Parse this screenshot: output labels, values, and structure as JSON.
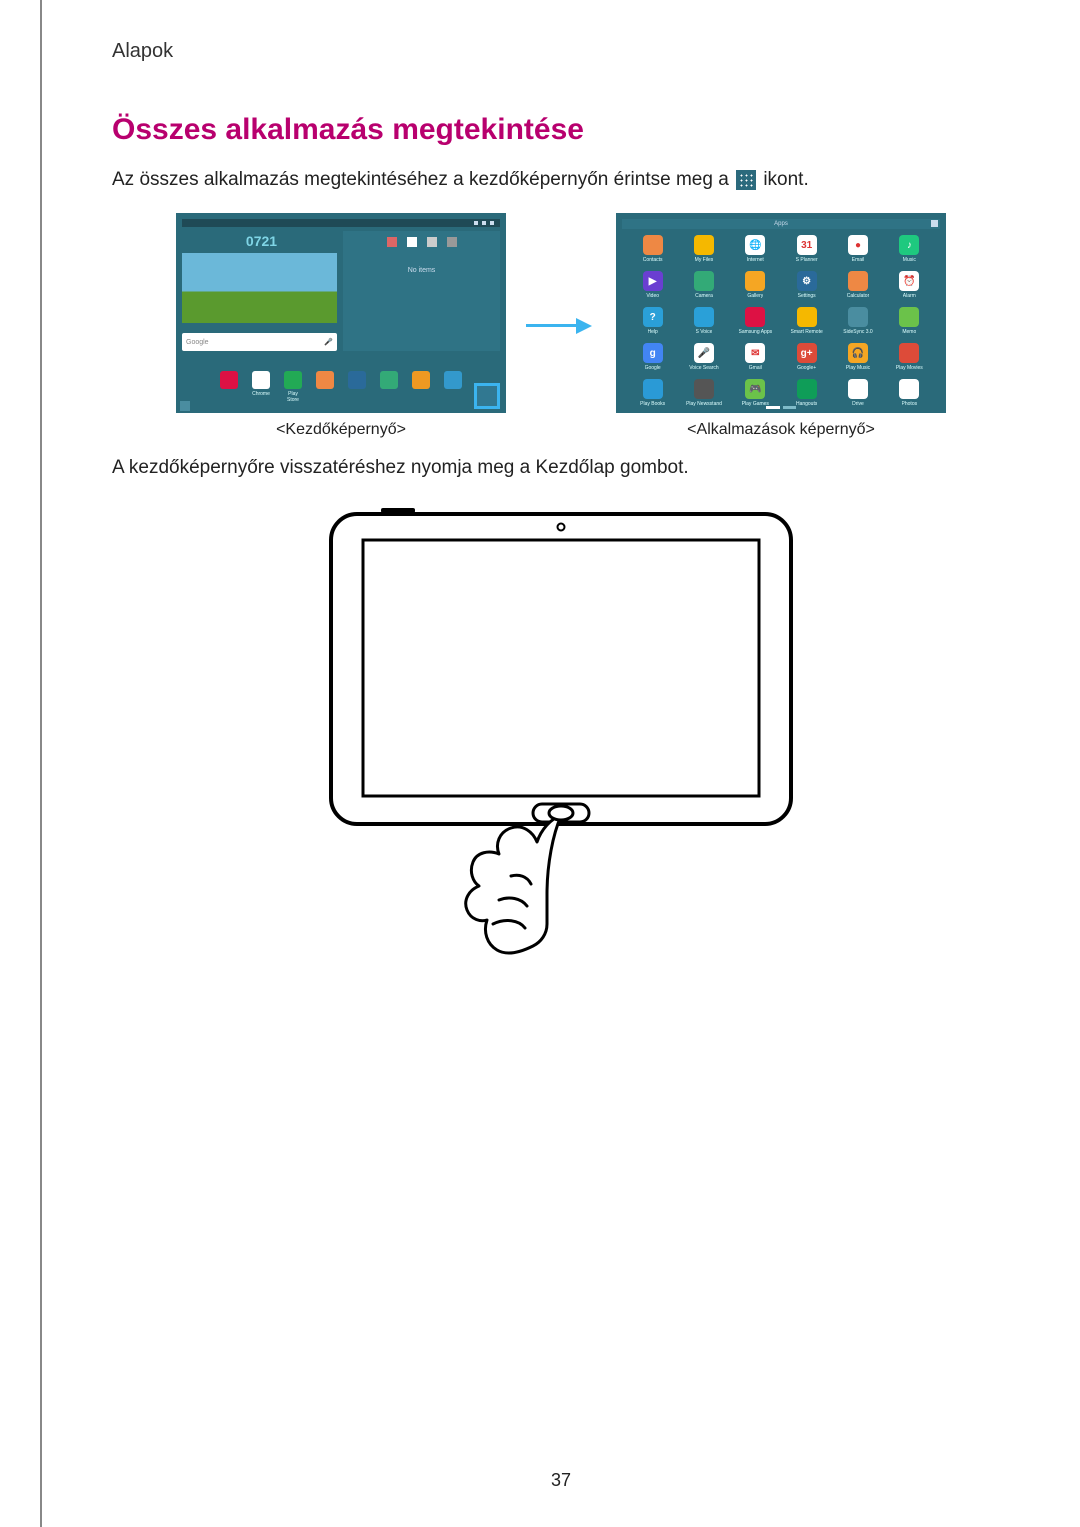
{
  "header": {
    "breadcrumb": "Alapok"
  },
  "section": {
    "title": "Összes alkalmazás megtekintése",
    "intro_before": "Az összes alkalmazás megtekintéséhez a kezdőképernyőn érintse meg a ",
    "intro_after": " ikont.",
    "caption_left": "<Kezdőképernyő>",
    "caption_right": "<Alkalmazások képernyő>",
    "return_text": "A kezdőképernyőre visszatéréshez nyomja meg a Kezdőlap gombot."
  },
  "home_screen": {
    "clock": "0721",
    "widget_text": "No items",
    "search_left": "Google",
    "search_right": "",
    "dock": [
      {
        "label": "",
        "color": "#d14"
      },
      {
        "label": "Chrome",
        "color": "#fff"
      },
      {
        "label": "Play Store",
        "color": "#2a5"
      },
      {
        "label": "",
        "color": "#e84"
      },
      {
        "label": "",
        "color": "#2a6a9a"
      },
      {
        "label": "",
        "color": "#3a7"
      },
      {
        "label": "",
        "color": "#e92"
      },
      {
        "label": "",
        "color": "#39c"
      }
    ]
  },
  "apps_screen": {
    "title": "Apps",
    "apps": [
      {
        "label": "Contacts",
        "color": "#e84",
        "glyph": ""
      },
      {
        "label": "My Files",
        "color": "#f5b800",
        "glyph": ""
      },
      {
        "label": "Internet",
        "color": "#fff",
        "glyph": "🌐"
      },
      {
        "label": "S Planner",
        "color": "#fff",
        "glyph": "31"
      },
      {
        "label": "Email",
        "color": "#fff",
        "glyph": "●"
      },
      {
        "label": "Music",
        "color": "#1ec97f",
        "glyph": "♪"
      },
      {
        "label": "Video",
        "color": "#6a3fd1",
        "glyph": "▶"
      },
      {
        "label": "Camera",
        "color": "#3a7",
        "glyph": ""
      },
      {
        "label": "Gallery",
        "color": "#f5a623",
        "glyph": ""
      },
      {
        "label": "Settings",
        "color": "#2a6a9a",
        "glyph": "⚙"
      },
      {
        "label": "Calculator",
        "color": "#e84",
        "glyph": ""
      },
      {
        "label": "Alarm",
        "color": "#fff",
        "glyph": "⏰"
      },
      {
        "label": "Help",
        "color": "#2aa0d8",
        "glyph": "?"
      },
      {
        "label": "S Voice",
        "color": "#2aa0d8",
        "glyph": ""
      },
      {
        "label": "Samsung Apps",
        "color": "#d14",
        "glyph": ""
      },
      {
        "label": "Smart Remote",
        "color": "#f5b800",
        "glyph": ""
      },
      {
        "label": "SideSync 3.0",
        "color": "#4a8da0",
        "glyph": ""
      },
      {
        "label": "Memo",
        "color": "#6bc24a",
        "glyph": ""
      },
      {
        "label": "Google",
        "color": "#4285f4",
        "glyph": "g"
      },
      {
        "label": "Voice Search",
        "color": "#fff",
        "glyph": "🎤"
      },
      {
        "label": "Gmail",
        "color": "#fff",
        "glyph": "✉"
      },
      {
        "label": "Google+",
        "color": "#dd4b39",
        "glyph": "g+"
      },
      {
        "label": "Play Music",
        "color": "#f5a623",
        "glyph": "🎧"
      },
      {
        "label": "Play Movies",
        "color": "#dd4b39",
        "glyph": ""
      },
      {
        "label": "Play Books",
        "color": "#2a9ad6",
        "glyph": ""
      },
      {
        "label": "Play Newsstand",
        "color": "#555",
        "glyph": ""
      },
      {
        "label": "Play Games",
        "color": "#6bc24a",
        "glyph": "🎮"
      },
      {
        "label": "Hangouts",
        "color": "#0f9d58",
        "glyph": ""
      },
      {
        "label": "Drive",
        "color": "#fff",
        "glyph": ""
      },
      {
        "label": "Photos",
        "color": "#fff",
        "glyph": ""
      }
    ]
  },
  "icons": {
    "apps_icon": "apps-grid-icon"
  },
  "page_number": "37"
}
